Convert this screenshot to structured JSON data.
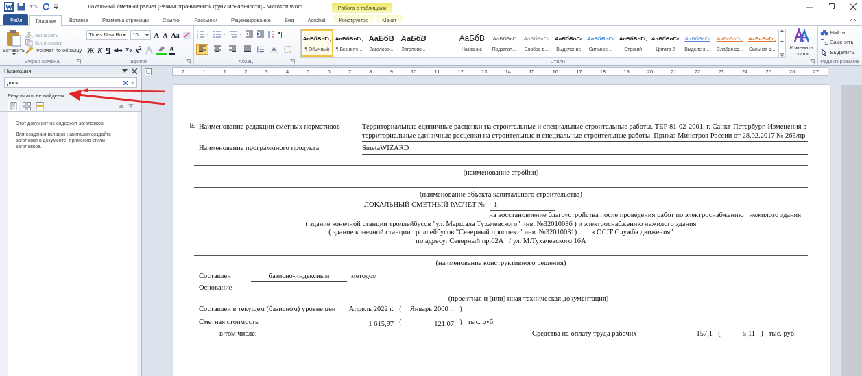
{
  "window": {
    "title": "Локальный сметный расчет [Режим ограниченной функциональности]  -  Microsoft Word",
    "context_group": "Работа с таблицами"
  },
  "tabs": [
    {
      "label": "Файл",
      "kind": "file",
      "selected": false
    },
    {
      "label": "Главная",
      "kind": "normal",
      "selected": true
    },
    {
      "label": "Вставка",
      "kind": "normal",
      "selected": false
    },
    {
      "label": "Разметка страницы",
      "kind": "normal",
      "selected": false
    },
    {
      "label": "Ссылки",
      "kind": "normal",
      "selected": false
    },
    {
      "label": "Рассылки",
      "kind": "normal",
      "selected": false
    },
    {
      "label": "Рецензирование",
      "kind": "normal",
      "selected": false
    },
    {
      "label": "Вид",
      "kind": "normal",
      "selected": false
    },
    {
      "label": "Acrobat",
      "kind": "normal",
      "selected": false
    },
    {
      "label": "Конструктор",
      "kind": "context",
      "selected": false
    },
    {
      "label": "Макет",
      "kind": "context",
      "selected": false
    }
  ],
  "ribbon": {
    "clipboard": {
      "label": "Буфер обмена",
      "paste": "Вставить",
      "items": [
        {
          "label": "Вырезать",
          "disabled": true
        },
        {
          "label": "Копировать",
          "disabled": true
        },
        {
          "label": "Формат по образцу",
          "disabled": false
        }
      ]
    },
    "font": {
      "label": "Шрифт",
      "font_name": "Times New Ro",
      "font_size": "10",
      "row1": [
        "A",
        "A",
        "Aa"
      ],
      "row2": [
        "Ж",
        "К",
        "Ч",
        "abc",
        "x$_{2}$",
        "x$^{2}$"
      ],
      "color_glyph": "A"
    },
    "paragraph": {
      "label": "Абзац",
      "pilcrow": "¶",
      "alignments": [
        {
          "kind": "left",
          "selected": true
        },
        {
          "kind": "center",
          "selected": false
        },
        {
          "kind": "right",
          "selected": false
        },
        {
          "kind": "justify",
          "selected": false
        }
      ]
    },
    "styles": {
      "label": "Стили",
      "items": [
        {
          "sample": "АаБбВвГг,",
          "name": "¶ Обычный",
          "kind": "normal",
          "selected": true
        },
        {
          "sample": "АаБбВвГг,",
          "name": "¶ Без инте...",
          "kind": "normal",
          "selected": false
        },
        {
          "sample": "АаБбВ",
          "name": "Заголово...",
          "kind": "heading",
          "selected": false
        },
        {
          "sample": "АаБбВ",
          "name": "Заголово...",
          "kind": "heading-italic",
          "selected": false
        },
        {
          "sample": "АаБбВ",
          "name": "Название",
          "kind": "title",
          "selected": false
        },
        {
          "sample": "АаБбВвГ",
          "name": "Подзагол...",
          "kind": "subtitle",
          "selected": false
        },
        {
          "sample": "АаБбВвГг",
          "name": "Слабое в...",
          "kind": "subtle",
          "selected": false
        },
        {
          "sample": "АаБбВвГг",
          "name": "Выделение",
          "kind": "emphasis",
          "selected": false
        },
        {
          "sample": "АаБбВвГг",
          "name": "Сильное ...",
          "kind": "intense",
          "selected": false
        },
        {
          "sample": "АаБбВвГг,",
          "name": "Строгий",
          "kind": "strong",
          "selected": false
        },
        {
          "sample": "АаБбВвГг",
          "name": "Цитата 2",
          "kind": "quote",
          "selected": false
        },
        {
          "sample": "АаБбВвГг",
          "name": "Выделенн...",
          "kind": "intense-quote",
          "selected": false
        },
        {
          "sample": "АаБбВвГг,",
          "name": "Слабая сс...",
          "kind": "subtle-ref",
          "selected": false
        },
        {
          "sample": "АаБбВвГг,",
          "name": "Сильная с...",
          "kind": "intense-ref",
          "selected": false
        }
      ]
    },
    "change_styles": "Изменить стили",
    "editing": {
      "label": "Редактирование",
      "items": [
        {
          "label": "Найти",
          "kind": "find"
        },
        {
          "label": "Заменить",
          "kind": "replace"
        },
        {
          "label": "Выделить",
          "kind": "select"
        }
      ]
    }
  },
  "navigation": {
    "title": "Навигация",
    "search_value": "доск",
    "result": "Результаты не найдены",
    "view_tabs": [
      {
        "kind": "headings",
        "selected": true
      },
      {
        "kind": "pages",
        "selected": false
      },
      {
        "kind": "results",
        "selected": false
      }
    ],
    "messages": [
      "Этот документ не содержит заголовков.",
      "Для создания вкладок навигации создайте заголовки в документе, применив стили заголовков."
    ]
  },
  "ruler": {
    "numbers": [
      "2",
      "1",
      "1",
      "2",
      "3",
      "4",
      "5",
      "6",
      "7",
      "8",
      "9",
      "10",
      "11",
      "12",
      "13",
      "14",
      "15",
      "16",
      "17",
      "18",
      "19",
      "20",
      "21",
      "22",
      "23",
      "24",
      "25",
      "26",
      "27"
    ]
  },
  "document": {
    "blocks": [
      {
        "kind": "pair",
        "label": "Наименование редакции сметных нормативов",
        "value": "Территориальные единичные расценки на строительные и специальные строительные работы. ТЕР 81-02-2001. г. Санкт-Петербург. Изменения в территориальные единичные расценки на строительные и специальные строительные работы. Приказ Минстроя России от 28.02.2017 № 265/пр"
      },
      {
        "kind": "pair",
        "label": "Наименование программного продукта",
        "value": "SmetaWIZARD"
      },
      {
        "kind": "caption",
        "text": "(наименование стройки)"
      },
      {
        "kind": "caption",
        "text": "(наименование объекта капитального строительства)"
      },
      {
        "kind": "title",
        "text": "ЛОКАЛЬНЫЙ СМЕТНЫЙ РАСЧЕТ №",
        "number": "1"
      },
      {
        "kind": "lines",
        "lines": [
          {
            "kind": "indented",
            "text": "на восстановление благоустройства после проведения работ по электроснабжению   нежилого здания"
          },
          {
            "kind": "centered",
            "text": "( здание конечной станции троллейбусов \"ул. Маршала Тухачевского\" инв. №32010036 ) и электроснабжению нежилого здания"
          },
          {
            "kind": "centered",
            "text": "( здание конечной станции троллейбусов \"Северный проспект\" инв. №32010031)        в ОСП\"Служба движения\""
          },
          {
            "kind": "centered",
            "text": "по адресу: Северный пр.62А   / ул. М.Тухачевского 16А"
          }
        ]
      },
      {
        "kind": "caption",
        "text": "(наименование конструктивного решения)"
      },
      {
        "kind": "method",
        "label": "Составлен",
        "value": "базисно-индексным",
        "suffix": "методом"
      },
      {
        "kind": "basis",
        "label": "Основание",
        "caption": "(проектная и (или) иная техническая документация)"
      },
      {
        "kind": "level",
        "label": "Составлен в текущем (базисном) уровне цен",
        "current": "Апрель 2022 г.",
        "base": "Январь 2000 г.",
        "open": "(",
        "close": ")"
      },
      {
        "kind": "cost",
        "label": "Сметная стоимость",
        "current": "1 615,97",
        "base": "121,07",
        "open": "(",
        "close": ")",
        "unit": "тыс. руб."
      },
      {
        "kind": "cost2",
        "label": "в том числе:",
        "right_label": "Средства на оплату труда рабочих",
        "current": "157,1",
        "base": "5,11",
        "open": "(",
        "close": ")",
        "unit": "тыс. руб."
      }
    ]
  }
}
